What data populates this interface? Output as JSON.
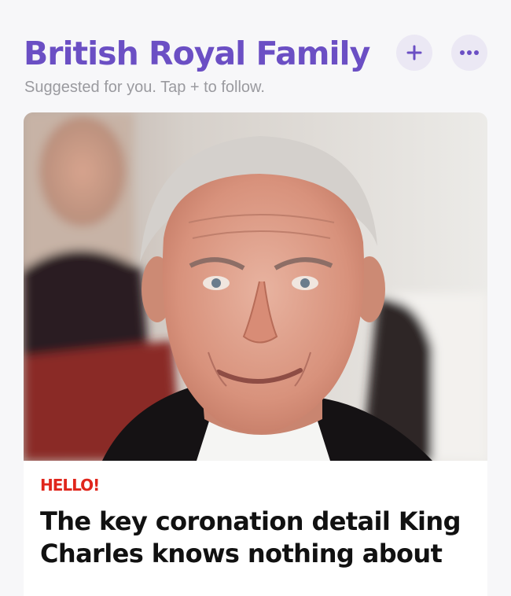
{
  "topic": {
    "title": "British Royal Family",
    "subtitle": "Suggested for you. Tap + to follow.",
    "follow_icon": "plus-icon",
    "more_icon": "ellipsis-icon",
    "accent_color": "#6b4fc4"
  },
  "article": {
    "image": "photo-king-charles",
    "publisher": "HELLO!",
    "publisher_color": "#e0261c",
    "headline": "The key coronation detail King Charles knows nothing about"
  }
}
